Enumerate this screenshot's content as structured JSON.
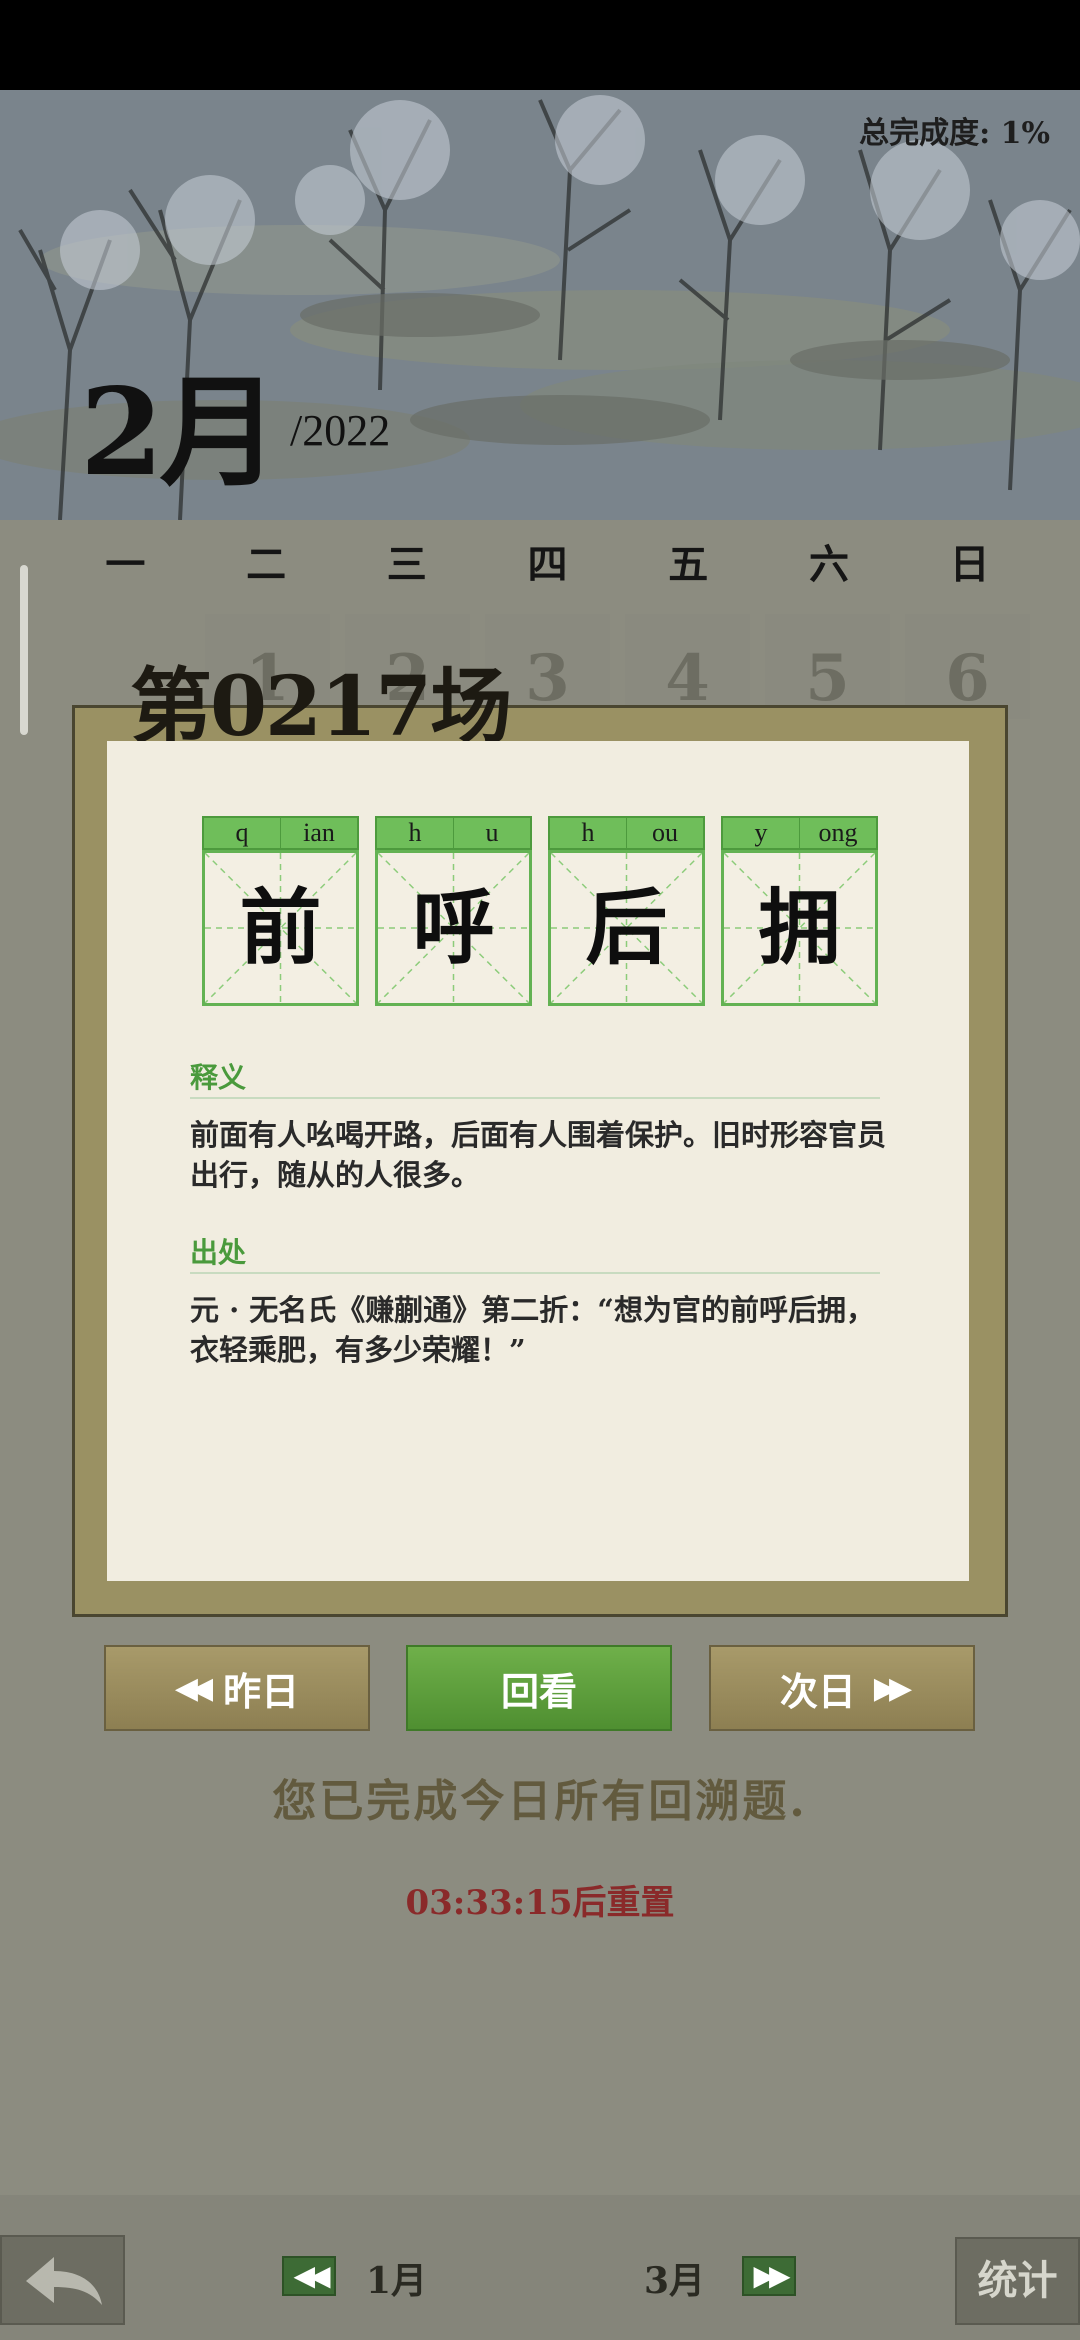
{
  "header": {
    "progress_label": "总完成度: 1%",
    "month": "2月",
    "year": "/2022"
  },
  "weekdays": [
    "一",
    "二",
    "三",
    "四",
    "五",
    "六",
    "日"
  ],
  "day_row": [
    "1",
    "2",
    "3",
    "4",
    "5",
    "6"
  ],
  "game": {
    "title": "第0217场",
    "idiom": [
      {
        "initial": "q",
        "final": "ian",
        "char": "前"
      },
      {
        "initial": "h",
        "final": "u",
        "char": "呼"
      },
      {
        "initial": "h",
        "final": "ou",
        "char": "后"
      },
      {
        "initial": "y",
        "final": "ong",
        "char": "拥"
      }
    ],
    "meaning_label": "释义",
    "meaning_text": "前面有人吆喝开路，后面有人围着保护。旧时形容官员出行，随从的人很多。",
    "source_label": "出处",
    "source_text": "元 · 无名氏《赚蒯通》第二折：“想为官的前呼后拥，衣轻乘肥，有多少荣耀！”"
  },
  "buttons": {
    "prev": "昨日",
    "review": "回看",
    "next": "次日"
  },
  "messages": {
    "done": "您已完成今日所有回溯题.",
    "reset": "03:33:15后重置"
  },
  "bottom_nav": {
    "prev_month": "1月",
    "next_month": "3月",
    "stats": "统计"
  },
  "icons": {
    "back": "back-arrow-icon",
    "rewind": "double-left-arrow-icon",
    "forward": "double-right-arrow-icon"
  },
  "colors": {
    "accent_green": "#5fa843",
    "reset_red": "#8a2a2a",
    "background": "#8c8c80"
  }
}
